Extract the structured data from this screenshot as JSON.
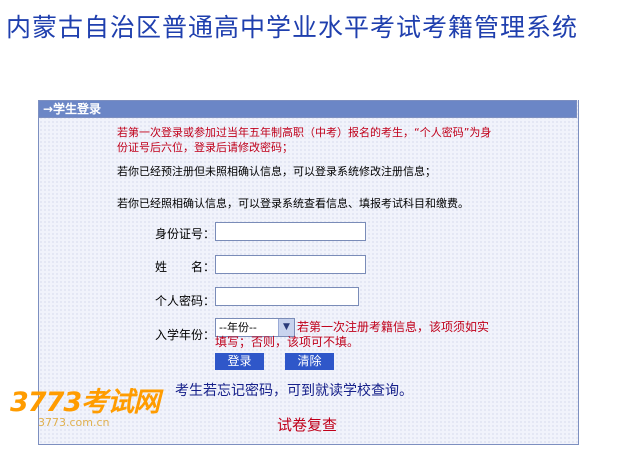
{
  "page_title": "内蒙古自治区普通高中学业水平考试考籍管理系统",
  "login_panel": {
    "header": "→学生登录",
    "notice_first_login": "若第一次登录或参加过当年五年制高职（中考）报名的考生，“个人密码”为身份证号后六位，登录后请修改密码；",
    "notice_preregistered": "若你已经预注册但未照相确认信息，可以登录系统修改注册信息；",
    "notice_confirmed": "若你已经照相确认信息，可以登录系统查看信息、填报考试科目和缴费。",
    "fields": {
      "id_label": "身份证号：",
      "id_value": "",
      "name_label": "姓　　名：",
      "name_value": "",
      "password_label": "个人密码：",
      "password_value": "",
      "year_label": "入学年份：",
      "year_selected": "--年份--",
      "year_note": "若第一次注册考籍信息，该项须如实填写；否则，该项可不填。"
    },
    "login_button": "登录",
    "clear_button": "清除",
    "forgot_password": "考生若忘记密码，可到就读学校查询。",
    "paper_recheck": "试卷复查"
  },
  "watermark": {
    "brand": "3773考试网",
    "url": "3773.com.cn"
  },
  "colors": {
    "title": "#1f3fae",
    "header_bg": "#6b86c6",
    "notice_red": "#c0001a",
    "button_bg": "#2f57c9",
    "watermark": "#ff9c00"
  }
}
